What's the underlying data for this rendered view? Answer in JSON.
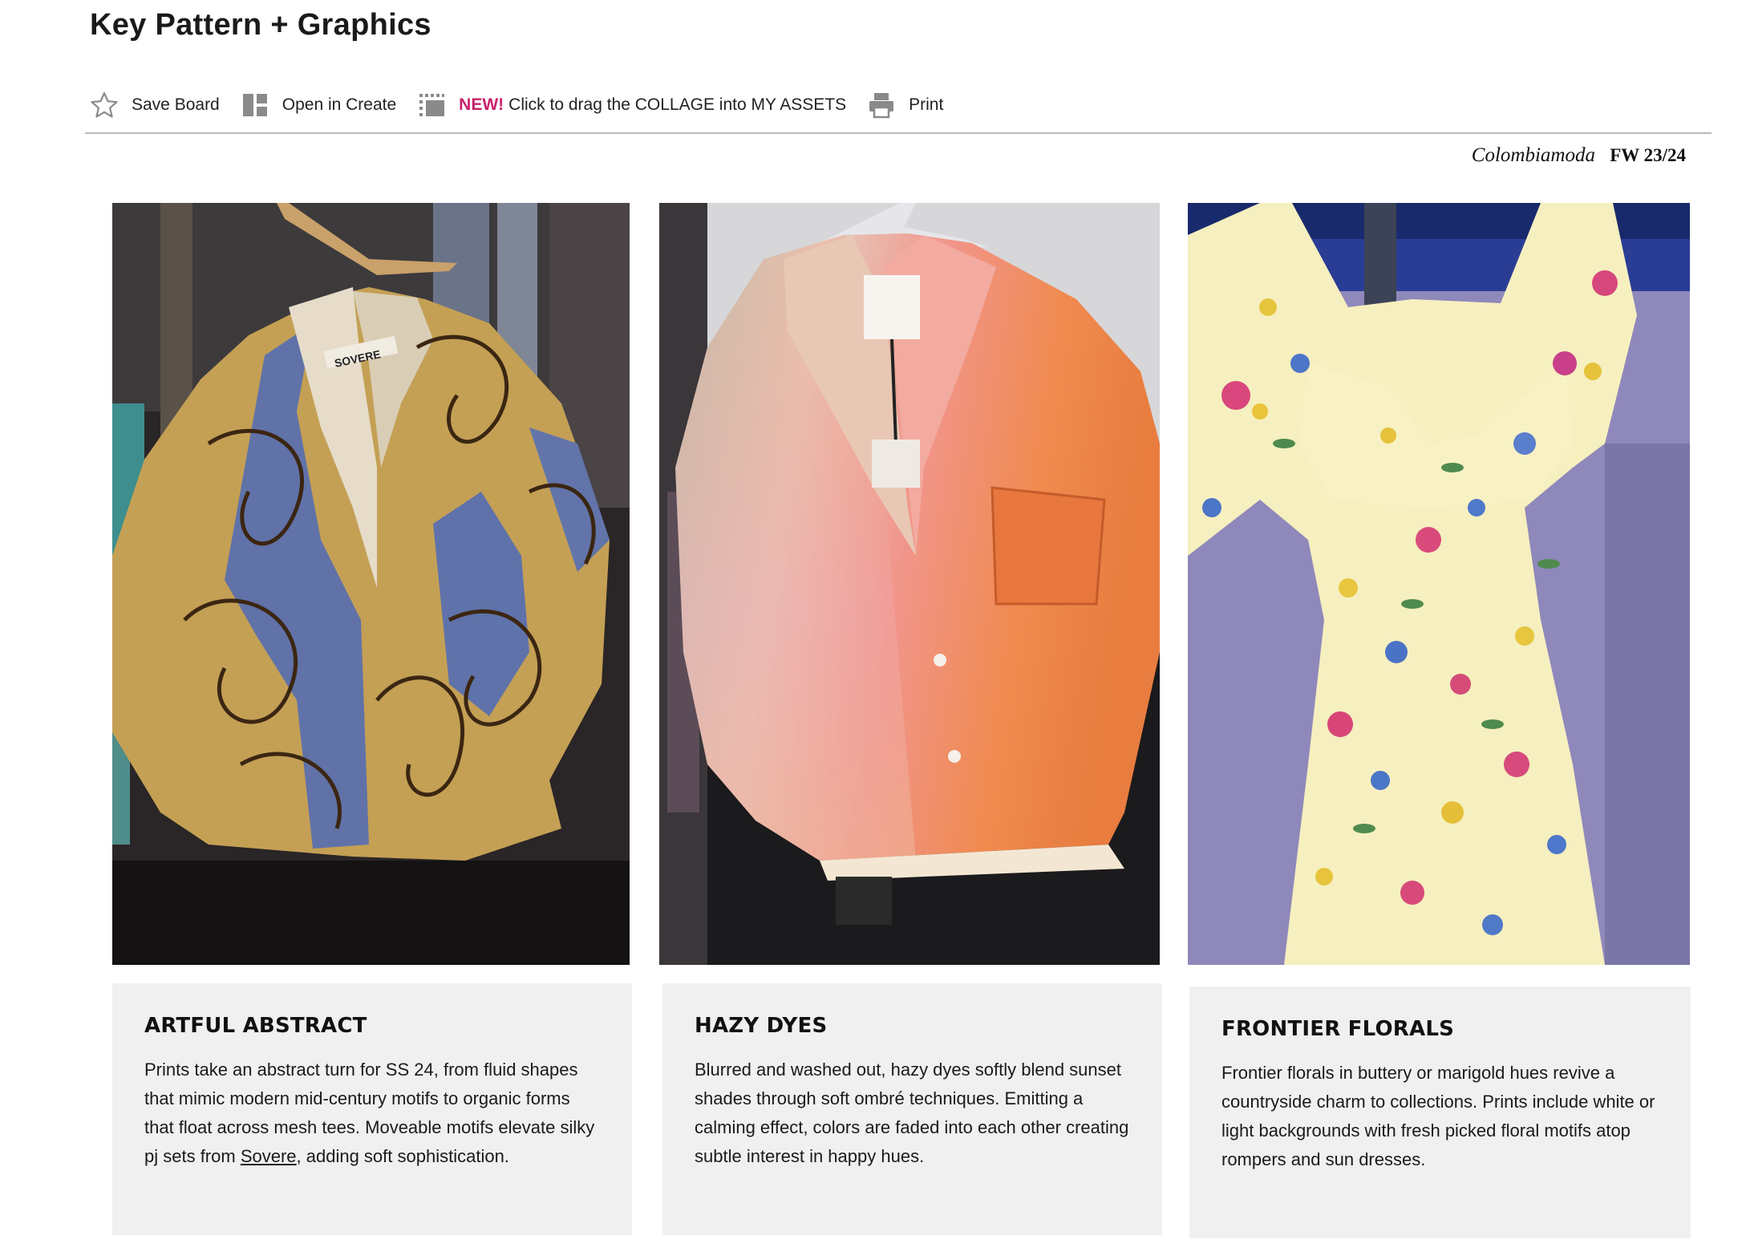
{
  "page_title": "Key Pattern + Graphics",
  "toolbar": {
    "save_label": "Save Board",
    "open_label": "Open in Create",
    "new_tag": "NEW!",
    "drag_label": "Click to drag the COLLAGE into MY ASSETS",
    "print_label": "Print"
  },
  "source": {
    "brand": "Colombiamoda",
    "season": "FW 23/24"
  },
  "cards": [
    {
      "title": "ARTFUL ABSTRACT",
      "text_before": "Prints take an abstract turn for SS 24, from fluid shapes that mimic modern mid-century motifs to organic forms that float across mesh tees. Moveable motifs elevate silky pj sets from ",
      "link": "Sovere",
      "text_after": ", adding soft sophistication."
    },
    {
      "title": "HAZY DYES",
      "text": "Blurred and washed out, hazy dyes softly blend sunset shades through soft ombré techniques. Emitting a calming effect, colors are faded into each other creating subtle interest in happy hues."
    },
    {
      "title": "FRONTIER FLORALS",
      "text": "Frontier florals in buttery or marigold hues revive a countryside charm to collections. Prints include white or light backgrounds with fresh picked floral motifs atop rompers and sun dresses."
    }
  ],
  "photo_labels": {
    "label_1": "SOVERE"
  },
  "colors": {
    "accent": "#c8206b",
    "card_bg": "#f0f0f0",
    "rule": "#b9b9b9"
  },
  "icons": [
    "star-icon",
    "open-in-create-icon",
    "collage-drag-icon",
    "print-icon"
  ]
}
